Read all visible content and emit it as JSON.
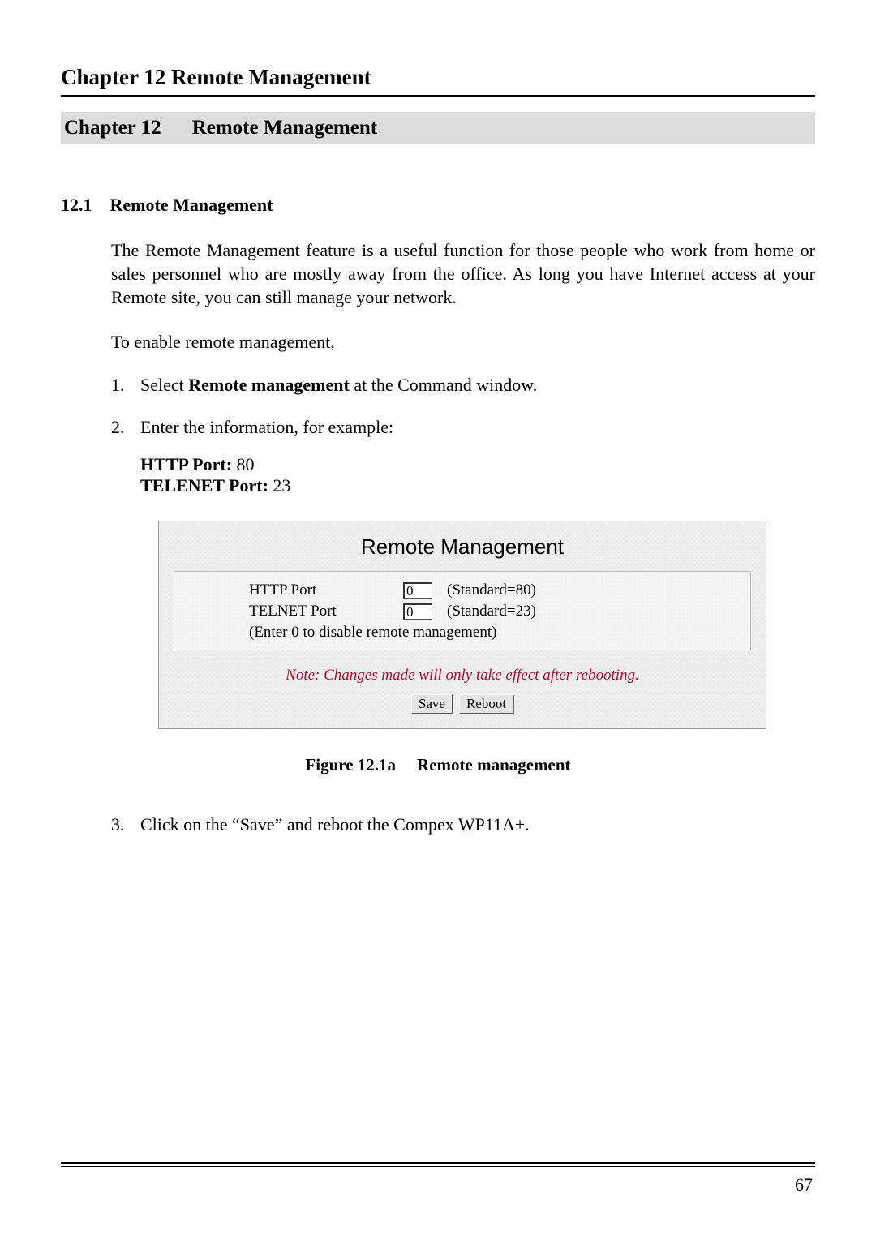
{
  "running_header": "Chapter 12    Remote Management",
  "chapter": {
    "label": "Chapter 12",
    "title": "Remote Management"
  },
  "section": {
    "number": "12.1",
    "title": "Remote Management"
  },
  "intro_paragraph": "The Remote Management feature is a useful function for those people who work from home or sales personnel who are mostly away from the office. As long you have Internet access at your Remote site, you can still manage your network.",
  "enable_lead": "To enable remote management,",
  "steps": {
    "s1_prefix": "Select ",
    "s1_bold": "Remote management",
    "s1_suffix": " at the Command window.",
    "s2": "Enter the information, for example:",
    "s3": "Click on the “Save” and reboot the Compex WP11A+."
  },
  "ports_example": {
    "http_label": "HTTP Port:",
    "http_value": "80",
    "telnet_label": "TELENET Port:",
    "telnet_value": "23"
  },
  "figure": {
    "title": "Remote Management",
    "http_label": "HTTP Port",
    "telnet_label": "TELNET Port",
    "input_value": "0",
    "http_hint": "(Standard=80)",
    "telnet_hint": "(Standard=23)",
    "disable_hint": "(Enter 0 to disable remote management)",
    "note": "Note: Changes made will only take effect after rebooting.",
    "save_btn": "Save",
    "reboot_btn": "Reboot"
  },
  "figure_caption": {
    "label": "Figure 12.1a",
    "title": "Remote management"
  },
  "page_number": "67"
}
